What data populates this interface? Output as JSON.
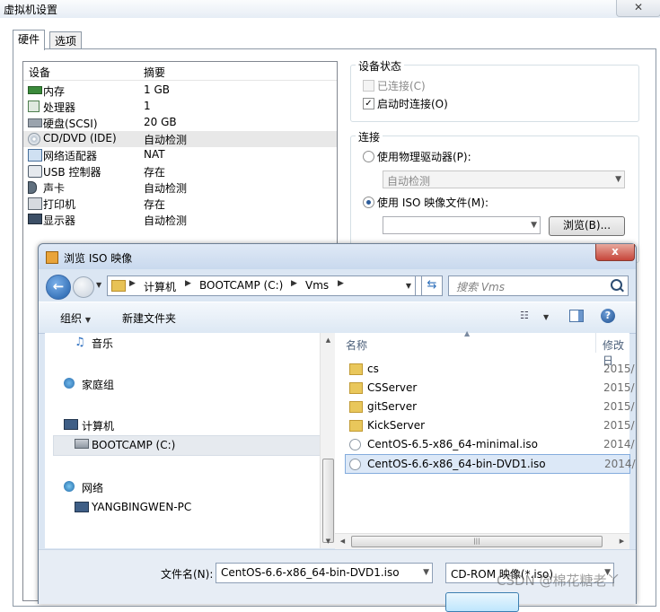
{
  "vm_settings": {
    "title": "虚拟机设置",
    "close_glyph": "✕",
    "tabs": [
      "硬件",
      "选项"
    ],
    "device_list": {
      "columns": [
        "设备",
        "摘要"
      ],
      "rows": [
        {
          "name": "内存",
          "summary": "1 GB",
          "icon": "memory-icon"
        },
        {
          "name": "处理器",
          "summary": "1",
          "icon": "processor-icon"
        },
        {
          "name": "硬盘(SCSI)",
          "summary": "20 GB",
          "icon": "hard-disk-icon"
        },
        {
          "name": "CD/DVD (IDE)",
          "summary": "自动检测",
          "icon": "cd-dvd-icon"
        },
        {
          "name": "网络适配器",
          "summary": "NAT",
          "icon": "network-adapter-icon"
        },
        {
          "name": "USB 控制器",
          "summary": "存在",
          "icon": "usb-icon"
        },
        {
          "name": "声卡",
          "summary": "自动检测",
          "icon": "sound-card-icon"
        },
        {
          "name": "打印机",
          "summary": "存在",
          "icon": "printer-icon"
        },
        {
          "name": "显示器",
          "summary": "自动检测",
          "icon": "display-icon"
        }
      ],
      "selected_index": 3
    },
    "device_status": {
      "title": "设备状态",
      "connected_label": "已连接(C)",
      "connect_on_power_label": "启动时连接(O)"
    },
    "connection": {
      "title": "连接",
      "physical_drive_label": "使用物理驱动器(P):",
      "physical_drive_value": "自动检测",
      "iso_label": "使用 ISO 映像文件(M):",
      "browse_label": "浏览(B)..."
    }
  },
  "browse_dialog": {
    "title": "浏览 ISO 映像",
    "close_glyph": "x",
    "breadcrumb": [
      "计算机",
      "BOOTCAMP (C:)",
      "Vms"
    ],
    "search_placeholder": "搜索 Vms",
    "toolbar": {
      "organize": "组织",
      "new_folder": "新建文件夹"
    },
    "nav": [
      {
        "label": "音乐",
        "icon": "music-icon"
      },
      {
        "label": "家庭组",
        "icon": "homegroup-icon"
      },
      {
        "label": "计算机",
        "icon": "computer-icon"
      },
      {
        "label": "BOOTCAMP (C:)",
        "icon": "drive-icon"
      },
      {
        "label": "网络",
        "icon": "network-icon"
      },
      {
        "label": "YANGBINGWEN-PC",
        "icon": "pc-icon"
      }
    ],
    "file_columns": {
      "name": "名称",
      "date": "修改日"
    },
    "files": [
      {
        "name": "cs",
        "date": "2015/",
        "type": "folder"
      },
      {
        "name": "CSServer",
        "date": "2015/",
        "type": "folder"
      },
      {
        "name": "gitServer",
        "date": "2015/",
        "type": "folder"
      },
      {
        "name": "KickServer",
        "date": "2015/",
        "type": "folder"
      },
      {
        "name": "CentOS-6.5-x86_64-minimal.iso",
        "date": "2014/",
        "type": "iso"
      },
      {
        "name": "CentOS-6.6-x86_64-bin-DVD1.iso",
        "date": "2014/",
        "type": "iso"
      }
    ],
    "selected_file_index": 5,
    "filename_label": "文件名(N):",
    "filename_value": "CentOS-6.6-x86_64-bin-DVD1.iso",
    "filter_value": "CD-ROM 映像(*.iso)"
  },
  "watermark": "CSDN @棉花糖老丫"
}
